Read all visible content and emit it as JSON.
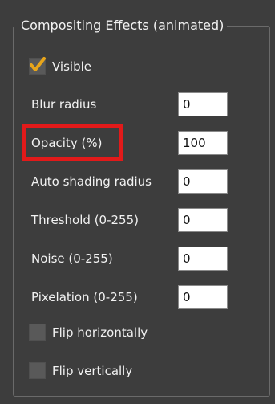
{
  "group": {
    "title": "Compositing Effects (animated)"
  },
  "visible": {
    "label": "Visible",
    "checked": true,
    "check_color": "#e8a51a"
  },
  "fields": [
    {
      "label": "Blur radius",
      "value": "0"
    },
    {
      "label": "Opacity (%)",
      "value": "100"
    },
    {
      "label": "Auto shading radius",
      "value": "0"
    },
    {
      "label": "Threshold (0-255)",
      "value": "0"
    },
    {
      "label": "Noise (0-255)",
      "value": "0"
    },
    {
      "label": "Pixelation (0-255)",
      "value": "0"
    }
  ],
  "flip_horizontal": {
    "label": "Flip horizontally",
    "checked": false
  },
  "flip_vertical": {
    "label": "Flip vertically",
    "checked": false
  },
  "annotation": {
    "highlight_color": "#e21a1a"
  }
}
